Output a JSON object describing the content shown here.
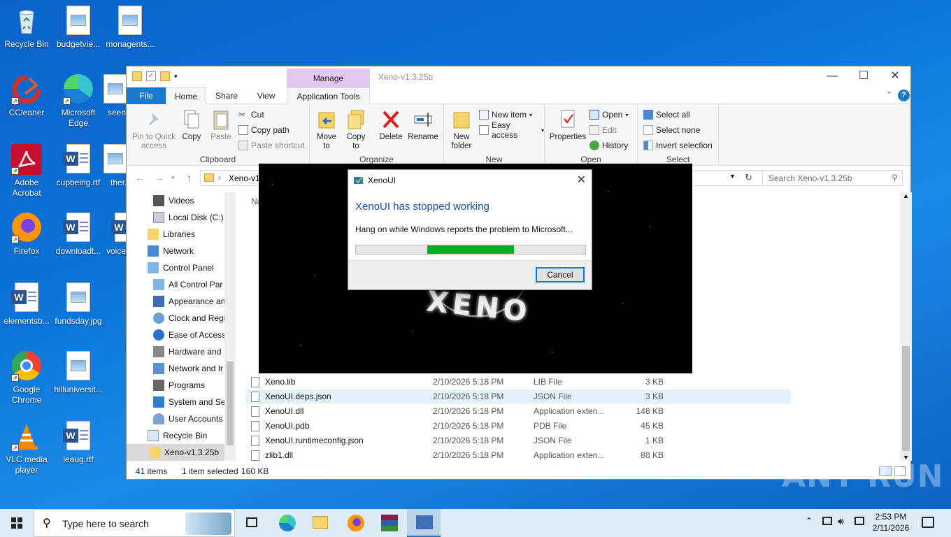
{
  "desktop": {
    "icons": [
      {
        "label": "Recycle Bin"
      },
      {
        "label": "budgetvie..."
      },
      {
        "label": "monagents..."
      },
      {
        "label": "CCleaner"
      },
      {
        "label": "Microsoft Edge"
      },
      {
        "label": "seen..."
      },
      {
        "label": "Adobe Acrobat"
      },
      {
        "label": "cupbeing.rtf"
      },
      {
        "label": "ther..."
      },
      {
        "label": "Firefox"
      },
      {
        "label": "downloadt..."
      },
      {
        "label": "voice..."
      },
      {
        "label": "elementsb..."
      },
      {
        "label": "fundsday.jpg"
      },
      {
        "label": "Google Chrome"
      },
      {
        "label": "hilluniversit..."
      },
      {
        "label": "VLC media player"
      },
      {
        "label": "ieaug.rtf"
      }
    ]
  },
  "explorer": {
    "window_title": "Xeno-v1.3.25b",
    "manage_tab": "Manage",
    "tabs": {
      "file": "File",
      "home": "Home",
      "share": "Share",
      "view": "View",
      "app_tools": "Application Tools"
    },
    "ribbon": {
      "clipboard": {
        "label": "Clipboard",
        "pin": "Pin to Quick access",
        "copy": "Copy",
        "paste": "Paste",
        "cut": "Cut",
        "copy_path": "Copy path",
        "paste_shortcut": "Paste shortcut"
      },
      "organize": {
        "label": "Organize",
        "move_to": "Move to",
        "copy_to": "Copy to",
        "delete": "Delete",
        "rename": "Rename"
      },
      "new": {
        "label": "New",
        "new_folder": "New folder",
        "new_item": "New item",
        "easy_access": "Easy access"
      },
      "open": {
        "label": "Open",
        "properties": "Properties",
        "open": "Open",
        "edit": "Edit",
        "history": "History"
      },
      "select": {
        "label": "Select",
        "select_all": "Select all",
        "select_none": "Select none",
        "invert": "Invert selection"
      }
    },
    "address": {
      "path": "Xeno-v1",
      "search_placeholder": "Search Xeno-v1.3.25b"
    },
    "nav": [
      {
        "label": "Videos"
      },
      {
        "label": "Local Disk (C:)"
      },
      {
        "label": "Libraries"
      },
      {
        "label": "Network"
      },
      {
        "label": "Control Panel"
      },
      {
        "label": "All Control Par"
      },
      {
        "label": "Appearance an"
      },
      {
        "label": "Clock and Regi"
      },
      {
        "label": "Ease of Access"
      },
      {
        "label": "Hardware and"
      },
      {
        "label": "Network and Ir"
      },
      {
        "label": "Programs"
      },
      {
        "label": "System and Se"
      },
      {
        "label": "User Accounts"
      },
      {
        "label": "Recycle Bin"
      },
      {
        "label": "Xeno-v1.3.25b"
      }
    ],
    "column_header_partial": "Na",
    "files": [
      {
        "name": "Xeno.lib",
        "date": "2/10/2026 5:18 PM",
        "type": "LIB File",
        "size": "3 KB"
      },
      {
        "name": "XenoUI.deps.json",
        "date": "2/10/2026 5:18 PM",
        "type": "JSON File",
        "size": "3 KB"
      },
      {
        "name": "XenoUI.dll",
        "date": "2/10/2026 5:18 PM",
        "type": "Application exten...",
        "size": "148 KB"
      },
      {
        "name": "XenoUI.pdb",
        "date": "2/10/2026 5:18 PM",
        "type": "PDB File",
        "size": "45 KB"
      },
      {
        "name": "XenoUI.runtimeconfig.json",
        "date": "2/10/2026 5:18 PM",
        "type": "JSON File",
        "size": "1 KB"
      },
      {
        "name": "zlib1.dll",
        "date": "2/10/2026 5:18 PM",
        "type": "Application exten...",
        "size": "88 KB"
      }
    ],
    "status": {
      "count": "41 items",
      "selected": "1 item selected",
      "size": "160 KB"
    }
  },
  "splash": {
    "logo_text": "XENO"
  },
  "dialog": {
    "title": "XenoUI",
    "heading": "XenoUI has stopped working",
    "message": "Hang on while Windows reports the problem to Microsoft...",
    "progress_start": 0.31,
    "progress_end": 0.69,
    "progress_color": "#06b025",
    "cancel_label": "Cancel"
  },
  "taskbar": {
    "search_placeholder": "Type here to search",
    "time": "2:53 PM",
    "date": "2/11/2026"
  },
  "watermark": "ANY RUN"
}
